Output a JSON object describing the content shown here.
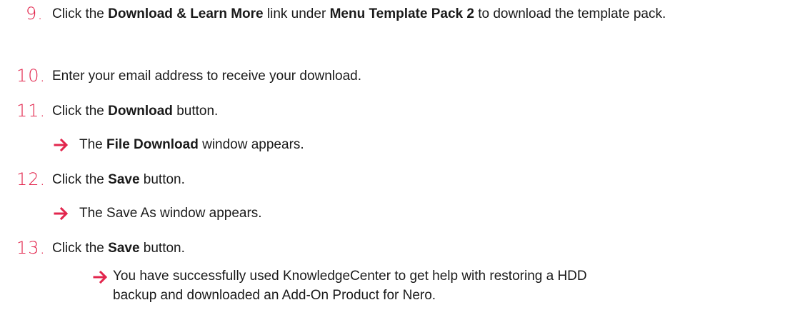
{
  "steps": [
    {
      "number": "9.",
      "parts": [
        "Click the ",
        "Download & Learn More",
        " link under ",
        "Menu Template Pack 2",
        " to download the template pack."
      ]
    },
    {
      "number": "10.",
      "text": "Enter your email address to receive your download."
    },
    {
      "number": "11.",
      "parts": [
        "Click the ",
        "Download",
        " button."
      ]
    },
    {
      "number": "12.",
      "parts": [
        "Click the ",
        "Save",
        " button."
      ]
    },
    {
      "number": "13.",
      "parts": [
        "Click the ",
        "Save",
        " button."
      ]
    }
  ],
  "results": [
    {
      "parts": [
        "The ",
        "File Download",
        " window appears."
      ]
    },
    {
      "text": "The Save As window appears."
    },
    {
      "line1": "You have successfully used KnowledgeCenter to get help with restoring a HDD",
      "line2": "backup and downloaded an Add-On Product for Nero."
    }
  ],
  "colors": {
    "accent": "#e2264d",
    "text": "#1a1a1a"
  },
  "icons": {
    "result_marker": "right-arrow-icon"
  }
}
